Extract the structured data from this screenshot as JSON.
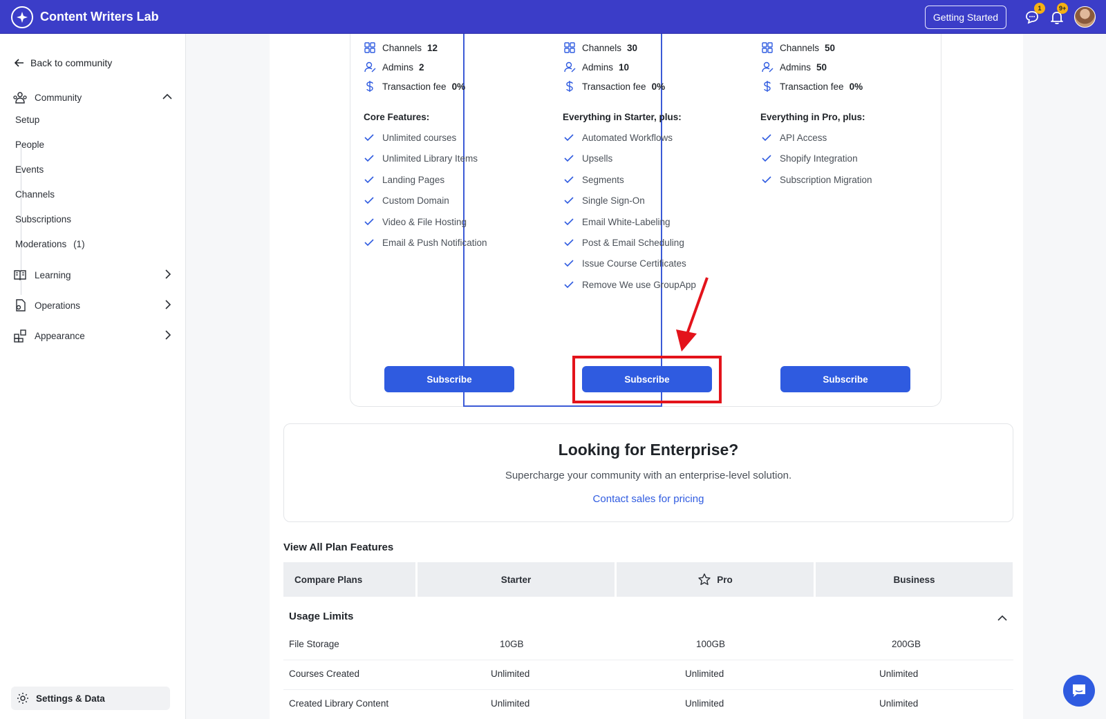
{
  "header": {
    "app_title": "Content Writers Lab",
    "getting_started_label": "Getting Started",
    "messages_badge": "1",
    "notifications_badge": "9+"
  },
  "sidebar": {
    "back_label": "Back to community",
    "community_label": "Community",
    "community_items": [
      "Setup",
      "People",
      "Events",
      "Channels",
      "Subscriptions",
      "Moderations"
    ],
    "moderations_count": "(1)",
    "learning_label": "Learning",
    "operations_label": "Operations",
    "appearance_label": "Appearance",
    "settings_label": "Settings & Data"
  },
  "plans": [
    {
      "name": "Starter",
      "channels_label": "Channels",
      "channels_value": "12",
      "admins_label": "Admins",
      "admins_value": "2",
      "fee_label": "Transaction fee",
      "fee_value": "0%",
      "features_title": "Core Features:",
      "features": [
        "Unlimited courses",
        "Unlimited Library Items",
        "Landing Pages",
        "Custom Domain",
        "Video & File Hosting",
        "Email & Push Notification"
      ],
      "subscribe_label": "Subscribe"
    },
    {
      "name": "Pro",
      "channels_label": "Channels",
      "channels_value": "30",
      "admins_label": "Admins",
      "admins_value": "10",
      "fee_label": "Transaction fee",
      "fee_value": "0%",
      "features_title": "Everything in Starter, plus:",
      "features": [
        "Automated Workflows",
        "Upsells",
        "Segments",
        "Single Sign-On",
        "Email White-Labeling",
        "Post & Email Scheduling",
        "Issue Course Certificates",
        "Remove We use GroupApp"
      ],
      "subscribe_label": "Subscribe"
    },
    {
      "name": "Business",
      "channels_label": "Channels",
      "channels_value": "50",
      "admins_label": "Admins",
      "admins_value": "50",
      "fee_label": "Transaction fee",
      "fee_value": "0%",
      "features_title": "Everything in Pro, plus:",
      "features": [
        "API Access",
        "Shopify Integration",
        "Subscription Migration"
      ],
      "subscribe_label": "Subscribe"
    }
  ],
  "enterprise": {
    "title": "Looking for Enterprise?",
    "subtitle": "Supercharge your community with an enterprise-level solution.",
    "link": "Contact sales for pricing"
  },
  "compare": {
    "section_title": "View All Plan Features",
    "headers": [
      "Compare Plans",
      "Starter",
      "Pro",
      "Business"
    ],
    "usage_title": "Usage Limits",
    "rows": [
      [
        "File Storage",
        "10GB",
        "100GB",
        "200GB"
      ],
      [
        "Courses Created",
        "Unlimited",
        "Unlimited",
        "Unlimited"
      ],
      [
        "Created Library Content",
        "Unlimited",
        "Unlimited",
        "Unlimited"
      ]
    ]
  },
  "colors": {
    "brand": "#3b3dc8",
    "primary_button": "#2f5be0",
    "annotation_red": "#e3131b"
  }
}
